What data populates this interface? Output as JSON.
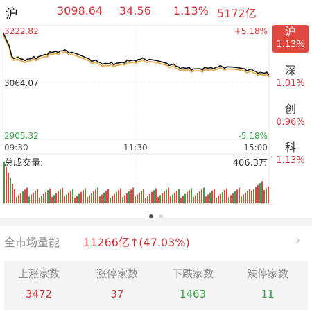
{
  "header": {
    "market": "沪",
    "price": "3098.64",
    "change": "34.56",
    "pct": "1.13%",
    "turnover": "5172亿"
  },
  "chart": {
    "y_top": "3222.82",
    "y_mid": "3064.07",
    "y_bottom": "2905.32",
    "pct_top": "+5.18%",
    "pct_bottom": "-5.18%",
    "time_start": "09:30",
    "time_mid": "11:30",
    "time_end": "15:00",
    "volume_label": "总成交量:",
    "volume_value": "406.3万",
    "colors": {
      "price_line": "#111111",
      "avg_line": "#e8a23a",
      "up": "#e0473e",
      "down": "#3aa34a"
    }
  },
  "side_tabs": [
    {
      "name": "沪",
      "pct": "1.13%",
      "active": true
    },
    {
      "name": "深",
      "pct": "1.01%",
      "active": false
    },
    {
      "name": "创",
      "pct": "0.96%",
      "active": false
    },
    {
      "name": "科",
      "pct": "1.13%",
      "active": false
    }
  ],
  "pager": {
    "pages": 2,
    "current": 1
  },
  "market_energy": {
    "label": "全市场量能",
    "value": "11266亿↑(47.03%)"
  },
  "stats": [
    {
      "label": "上涨家数",
      "value": "3472",
      "color": "#d0353a"
    },
    {
      "label": "涨停家数",
      "value": "37",
      "color": "#d0353a"
    },
    {
      "label": "下跌家数",
      "value": "1463",
      "color": "#3aa34a"
    },
    {
      "label": "跌停家数",
      "value": "11",
      "color": "#3aa34a"
    }
  ]
}
